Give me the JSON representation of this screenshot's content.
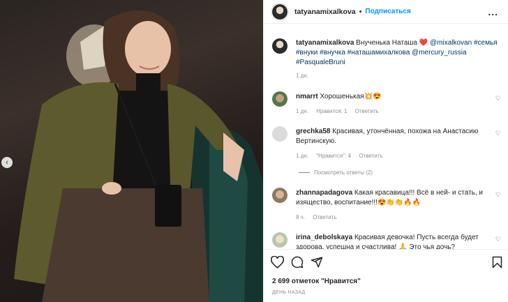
{
  "post": {
    "username": "tatyanamixalkova",
    "separator": "•",
    "follow_label": "Подписаться",
    "more_label": "...",
    "caption_text": "Внученька Наташа ❤️",
    "caption_tags": "@mixalkovan #семья #внуки #внучка #наташамихалкова @mercury_russia #PasqualeBruni",
    "caption_time": "1 дн."
  },
  "comments": [
    {
      "user": "nmarrt",
      "text": "Хорошенькая💥😍",
      "time": "1 дн.",
      "likes": "Нравится: 1",
      "reply": "Ответить"
    },
    {
      "user": "grechka58",
      "text": "Красивая, утончённая, похожа на Анастасию Вертинскую.",
      "time": "1 дн.",
      "likes": "\"Нравится\": 4",
      "reply": "Ответить",
      "view_replies": "Посмотреть ответы (2)"
    },
    {
      "user": "zhannapadagova",
      "text": "Какая красавица!!! Всё в ней- и стать, и изящество, воспитание!!!😍👏👏🔥🔥",
      "time": "8 ч.",
      "reply": "Ответить"
    },
    {
      "user": "irina_debolskaya",
      "text": "Красивая девочка! Пусть всегда будет здорова, успешна и счастлива! 🙏 Это чья дочь?"
    }
  ],
  "footer": {
    "likes_text": "2 699 отметок \"Нравится\"",
    "time_ago": "День назад"
  },
  "icons": {
    "heart": "heart-icon",
    "comment": "comment-icon",
    "share": "share-icon",
    "save": "bookmark-icon",
    "prev": "chevron-left-icon"
  }
}
